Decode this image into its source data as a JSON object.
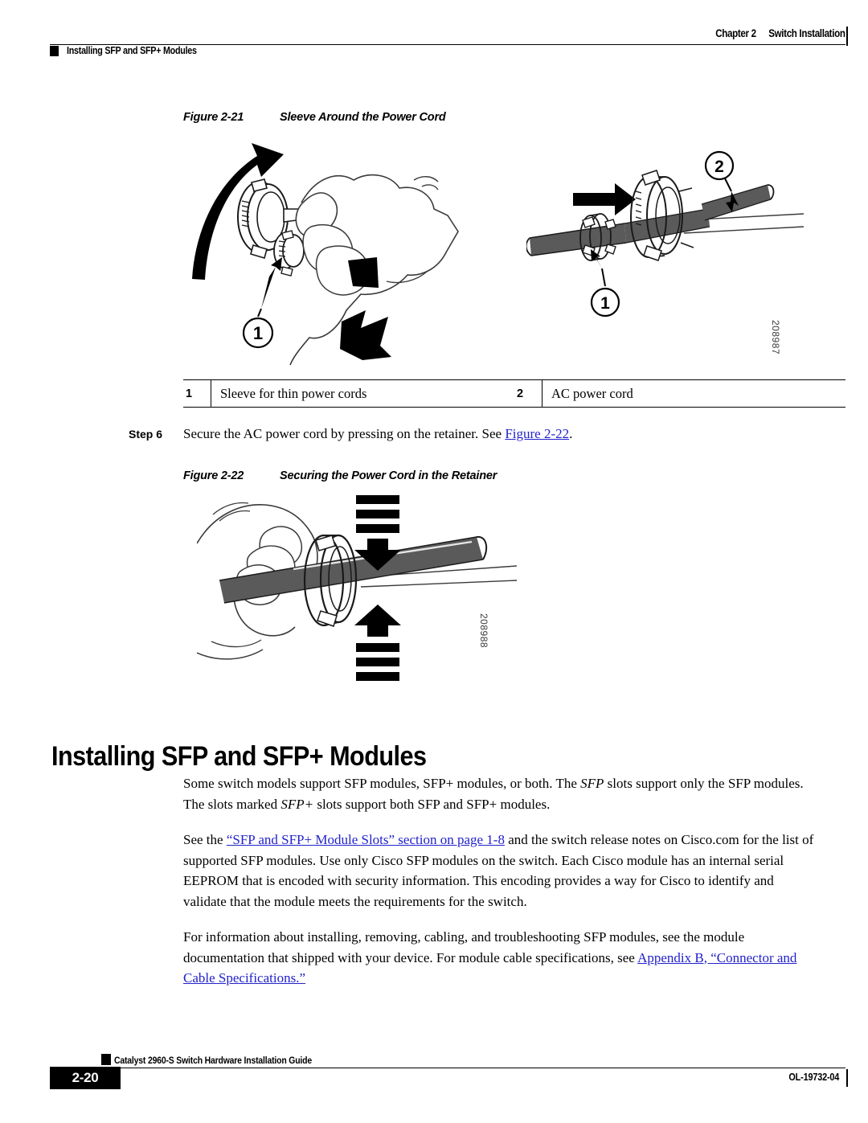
{
  "header": {
    "chapter": "Chapter 2",
    "chapter_title": "Switch Installation",
    "section": "Installing SFP and SFP+ Modules"
  },
  "figure_1": {
    "number": "Figure 2-21",
    "title": "Sleeve Around the Power Cord",
    "image_id": "208987",
    "callouts": [
      "1",
      "2",
      "1"
    ]
  },
  "legend": {
    "rows": [
      {
        "num": "1",
        "text": "Sleeve for thin power cords"
      },
      {
        "num": "2",
        "text": "AC power cord"
      }
    ]
  },
  "step": {
    "label": "Step 6",
    "text_before": "Secure the AC power cord by pressing on the retainer. See ",
    "link": "Figure 2-22",
    "text_after": "."
  },
  "figure_2": {
    "number": "Figure 2-22",
    "title": "Securing the Power Cord in the Retainer",
    "image_id": "208988"
  },
  "heading": {
    "title": "Installing SFP and SFP+ Modules"
  },
  "paragraphs": {
    "p1_a": "Some switch models support SFP modules, SFP+ modules, or both. The ",
    "p1_i1": "SFP",
    "p1_b": " slots support only the SFP modules. The slots marked ",
    "p1_i2": "SFP+",
    "p1_c": " slots support both SFP and SFP+ modules.",
    "p2_a": "See the ",
    "p2_link": "“SFP and SFP+ Module Slots” section on page 1-8",
    "p2_b": " and the switch release notes on Cisco.com for the list of supported SFP modules. Use only Cisco SFP modules on the switch. Each Cisco module has an internal serial EEPROM that is encoded with security information. This encoding provides a way for Cisco to identify and validate that the module meets the requirements for the switch.",
    "p3_a": "For information about installing, removing, cabling, and troubleshooting SFP modules, see the module documentation that shipped with your device. For module cable specifications, see ",
    "p3_link": "Appendix B, “Connector and Cable Specifications.”"
  },
  "footer": {
    "page": "2-20",
    "guide": "Catalyst 2960-S Switch Hardware Installation Guide",
    "doc_id": "OL-19732-04"
  },
  "colors": {
    "link": "#2222cc",
    "cord": "#5a5a5a",
    "ink": "#000000"
  }
}
